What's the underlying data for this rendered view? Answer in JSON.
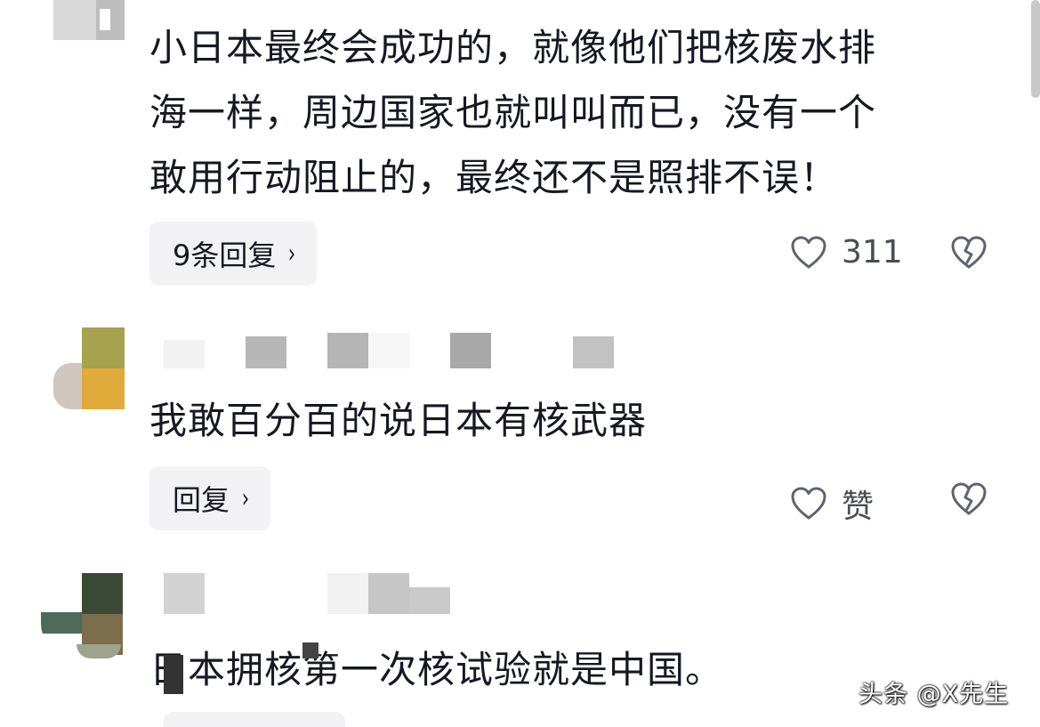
{
  "comments": [
    {
      "text_lines": [
        "小日本最终会成功的，就像他们把核废水排",
        "海一样，周边国家也就叫叫而已，没有一个",
        "敢用行动阻止的，最终还不是照排不误！"
      ],
      "reply_label": "9条回复",
      "like_label": "311"
    },
    {
      "text_lines": [
        "我敢百分百的说日本有核武器"
      ],
      "reply_label": "回复",
      "like_label": "赞"
    },
    {
      "text_lines": [
        "日本拥核第一次核试验就是中国。"
      ]
    }
  ],
  "icons": {
    "chevron": "›",
    "like": "heart-outline-icon",
    "dislike": "broken-heart-icon"
  },
  "watermark": "头条 @X先生",
  "colors": {
    "text": "#161823",
    "secondary": "#4b4d55",
    "reply_bg": "#f2f2f4",
    "icon": "#606270"
  }
}
